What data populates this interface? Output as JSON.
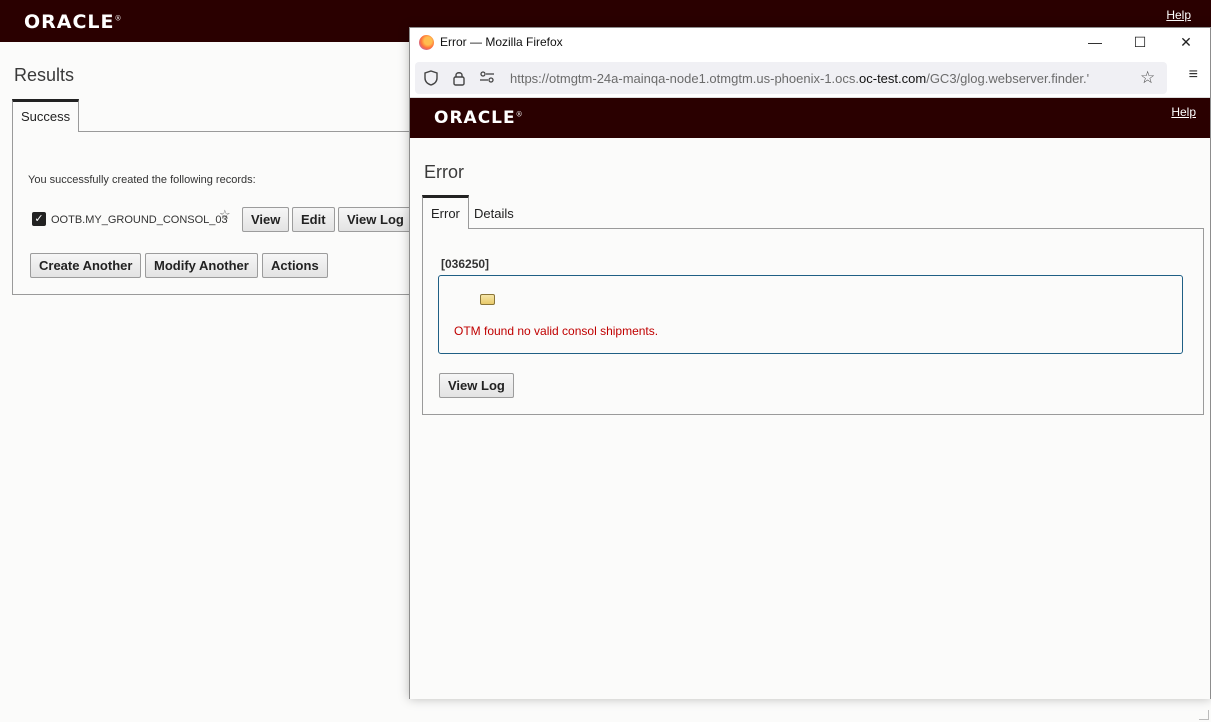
{
  "background_page": {
    "logo": "ORACLE",
    "help_label": "Help",
    "title": "Results",
    "tabs": [
      {
        "label": "Success"
      }
    ],
    "info_text": "You successfully created the following records:",
    "record": {
      "id": "OOTB.MY_GROUND_CONSOL_03",
      "checked": true
    },
    "record_buttons": {
      "view": "View",
      "edit": "Edit",
      "view_log": "View Log"
    },
    "action_buttons": {
      "create_another": "Create Another",
      "modify_another": "Modify Another",
      "actions": "Actions"
    }
  },
  "browser": {
    "window_title": "Error — Mozilla Firefox",
    "url_prefix": "https://otmgtm-24a-mainqa-node1.otmgtm.us-phoenix-1.ocs.",
    "url_host": "oc-test.com",
    "url_suffix": "/GC3/glog.webserver.finder.'",
    "controls": {
      "minimize": "—",
      "maximize": "☐",
      "close": "✕",
      "menu": "≡"
    },
    "icons": [
      "firefox-icon",
      "shield-icon",
      "lock-icon",
      "permissions-icon",
      "star-icon",
      "menu-icon"
    ]
  },
  "error_page": {
    "logo": "ORACLE",
    "help_label": "Help",
    "title": "Error",
    "tabs": [
      {
        "label": "Error",
        "active": true
      },
      {
        "label": "Details",
        "active": false
      }
    ],
    "error_code": "[036250]",
    "message": "OTM found no valid consol shipments.",
    "view_log_label": "View Log"
  },
  "colors": {
    "header": "#2a0000",
    "error_text": "#c00000",
    "message_border": "#1f5f85"
  }
}
